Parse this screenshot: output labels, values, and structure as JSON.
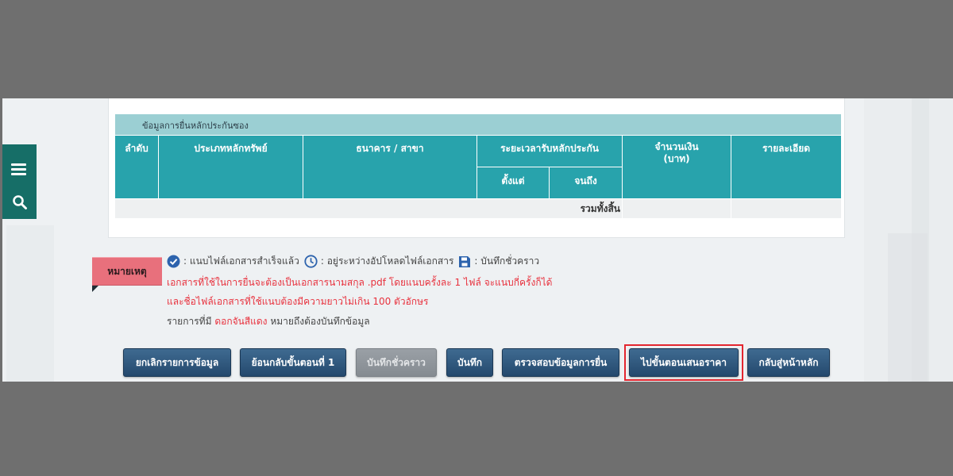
{
  "sidebar": {
    "menu_icon": "hamburger-menu-icon",
    "search_icon": "search-icon"
  },
  "table": {
    "caption": "ข้อมูลการยื่นหลักประกันซอง",
    "columns": {
      "order": "ลำดับ",
      "security_type": "ประเภทหลักทรัพย์",
      "bank_branch": "ธนาคาร / สาขา",
      "period": "ระยะเวลารับหลักประกัน",
      "period_from": "ตั้งแต่",
      "period_to": "จนถึง",
      "amount": "จำนวนเงิน\n(บาท)",
      "details": "รายละเอียด"
    },
    "total_label": "รวมทั้งสิ้น"
  },
  "remark": {
    "badge": "หมายเหตุ",
    "legend": {
      "uploaded": ": แนบไฟล์เอกสารสำเร็จแล้ว",
      "uploading": ": อยู่ระหว่างอัปโหลดไฟล์เอกสาร",
      "draft": ": บันทึกชั่วคราว"
    },
    "line2": "เอกสารที่ใช้ในการยื่นจะต้องเป็นเอกสารนามสกุล .pdf โดยแนบครั้งละ 1 ไฟล์ จะแนบกี่ครั้งก็ได้",
    "line3": "และชื่อไฟล์เอกสารที่ใช้แนบต้องมีความยาวไม่เกิน 100 ตัวอักษร",
    "line4_before": "รายการที่มี",
    "line4_red": "ดอกจันสีแดง",
    "line4_after": "หมายถึงต้องบันทึกข้อมูล"
  },
  "buttons": {
    "cancel_record": "ยกเลิกรายการข้อมูล",
    "back_step1": "ย้อนกลับขั้นตอนที่ 1",
    "save_draft": "บันทึกชั่วคราว",
    "save": "บันทึก",
    "verify": "ตรวจสอบข้อมูลการยื่น",
    "go_bidding": "ไปขั้นตอนเสนอราคา",
    "home": "กลับสู่หน้าหลัก"
  },
  "colors": {
    "table_header": "#28a3ac",
    "table_caption": "#9bcfd3",
    "button": "#2c5378",
    "highlight": "#e3262f",
    "remark_badge": "#e8707c",
    "sidebar": "#166e67"
  }
}
